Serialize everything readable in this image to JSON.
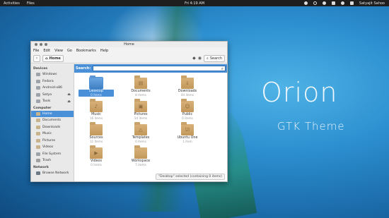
{
  "top_panel": {
    "activities": "Activities",
    "app_menu": "Files",
    "clock": "Fri 4:19 AM",
    "user": "Satyajit Sahoo"
  },
  "headline": {
    "title": "Orion",
    "subtitle": "GTK Theme"
  },
  "window": {
    "title": "Home",
    "menu": [
      "File",
      "Edit",
      "View",
      "Go",
      "Bookmarks",
      "Help"
    ],
    "location": "Home",
    "search_button": "Search",
    "search_label": "Search:",
    "search_value": "",
    "sidebar": {
      "devices_header": "Devices",
      "devices": [
        "Windows",
        "Fedora",
        "Android-x86",
        "Satya",
        "Tools"
      ],
      "computer_header": "Computer",
      "computer": [
        "Home",
        "Documents",
        "Downloads",
        "Music",
        "Pictures",
        "Videos",
        "File System",
        "Trash"
      ],
      "network_header": "Network",
      "network": [
        "Browse Network"
      ]
    },
    "files": [
      {
        "name": "Desktop",
        "count": "0 items"
      },
      {
        "name": "Documents",
        "count": "8 items"
      },
      {
        "name": "Downloads",
        "count": "44 items"
      },
      {
        "name": "Music",
        "count": "16 items"
      },
      {
        "name": "Pictures",
        "count": "14 items"
      },
      {
        "name": "Public",
        "count": "0 items"
      },
      {
        "name": "Sources",
        "count": "11 items"
      },
      {
        "name": "Templates",
        "count": "0 items"
      },
      {
        "name": "Ubuntu One",
        "count": "1 item"
      },
      {
        "name": "Videos",
        "count": "0 items"
      },
      {
        "name": "Workspace",
        "count": "7 items"
      }
    ],
    "status": "\"Desktop\" selected (containing 0 items)"
  }
}
